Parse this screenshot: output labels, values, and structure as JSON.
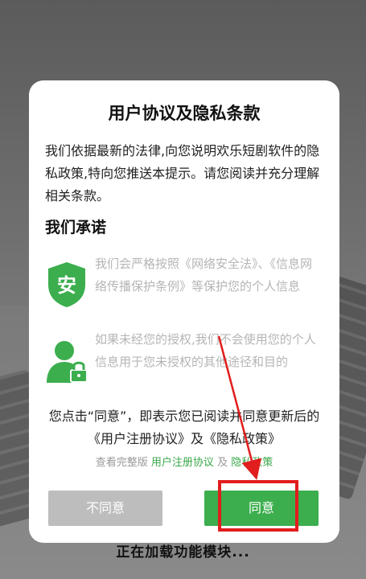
{
  "dialog": {
    "title": "用户协议及隐私条款",
    "intro": "我们依据最新的法律,向您说明欢乐短剧软件的隐私政策,特向您推送本提示。请您阅读并充分理解相关条款。",
    "subhead": "我们承诺",
    "commitments": [
      {
        "icon": "shield-icon",
        "icon_text": "安",
        "text": "我们会严格按照《网络安全法》、《信息网络传播保护条例》等保护您的个人信息"
      },
      {
        "icon": "user-lock-icon",
        "text": "如果未经您的授权,我们不会使用您的个人信息用于您未授权的其他途径和目的"
      }
    ],
    "consent": "您点击“同意”，即表示您已阅读并同意更新后的《用户注册协议》及《隐私政策》",
    "links": {
      "prefix": "查看完整版",
      "user_agreement": "用户注册协议",
      "and": "及",
      "privacy_policy": "隐私政策"
    },
    "buttons": {
      "disagree": "不同意",
      "agree": "同意"
    }
  },
  "background": {
    "loading_text": "正在加载功能模块..."
  },
  "colors": {
    "accent": "#3cae4e",
    "annotation": "#e11d1d",
    "disabled": "#bdbdbd"
  }
}
